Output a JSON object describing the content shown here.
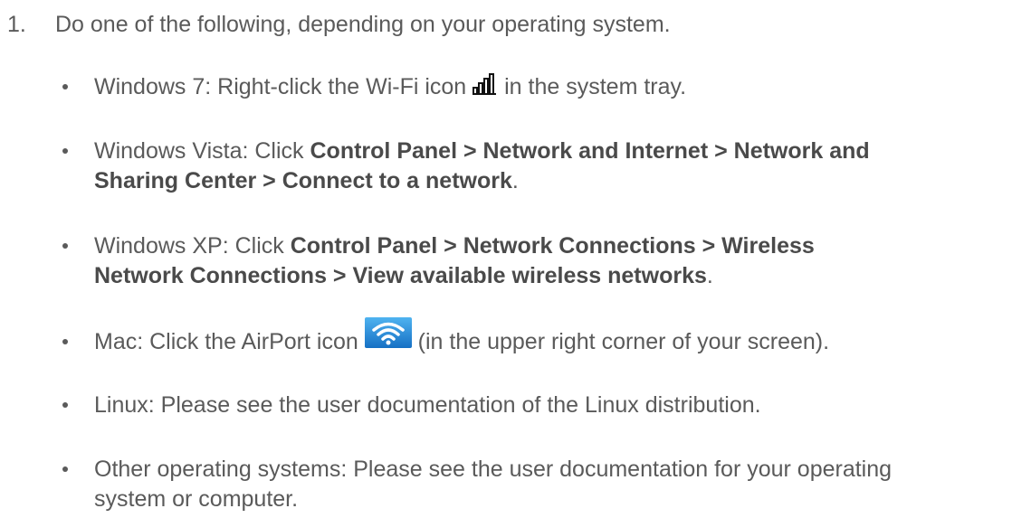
{
  "step": {
    "number": "1.",
    "text": "Do one of the following, depending on your operating system."
  },
  "bullets": [
    {
      "prefix": "Windows 7: Right-click the Wi-Fi icon",
      "suffix": "in the system tray.",
      "icon": "wifi-signal-bars-icon"
    },
    {
      "prefix": "Windows Vista: Click",
      "bold1": "Control Panel > Network and Internet > Network and",
      "bold2": "Sharing Center > Connect to a network",
      "end": "."
    },
    {
      "prefix": "Windows XP: Click",
      "bold1": "Control Panel > Network Connections > Wireless",
      "bold2": "Network Connections > View available wireless networks",
      "end": "."
    },
    {
      "prefix": "Mac: Click the AirPort icon",
      "suffix": "(in the upper right corner of your screen).",
      "icon": "airport-wifi-icon",
      "icon_color": "#1e8fd8"
    },
    {
      "text": "Linux: Please see the user documentation of the Linux distribution."
    },
    {
      "line1": "Other operating systems: Please see the user documentation for your operating",
      "line2": "system or computer."
    }
  ]
}
